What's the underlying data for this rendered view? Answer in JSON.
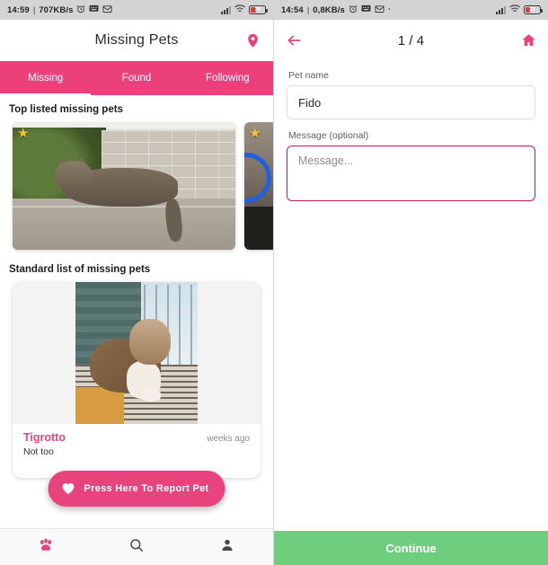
{
  "left": {
    "statusbar": {
      "clock": "14:59",
      "separator": "|",
      "netspeed": "707KB/s",
      "alarm_icon": "alarm-icon",
      "message_icon": "message-icon",
      "mail_icon": "mail-icon",
      "signal_icon": "signal-icon",
      "wifi_icon": "wifi-icon",
      "battery_icon": "battery-icon",
      "battery_level": "18"
    },
    "appbar": {
      "title": "Missing Pets",
      "action_icon": "location-pin-icon"
    },
    "tabs": [
      {
        "label": "Missing",
        "active": true
      },
      {
        "label": "Found",
        "active": false
      },
      {
        "label": "Following",
        "active": false
      }
    ],
    "sections": {
      "top_title": "Top listed missing pets",
      "standard_title": "Standard list of missing pets"
    },
    "top_cards": [
      {
        "badge_icon": "star-icon",
        "photo": "tabby-cat-on-wall"
      },
      {
        "badge_icon": "star-icon",
        "photo": "pet-with-blue-ring"
      }
    ],
    "standard_card": {
      "photo": "cat-on-porch-rug",
      "pet_name": "Tigrotto",
      "time_ago": "weeks ago",
      "description": "Not too"
    },
    "fab": {
      "icon": "heart-icon",
      "label": "Press Here To Report Pet"
    },
    "bottom_nav": [
      {
        "icon": "paw-icon",
        "active": true
      },
      {
        "icon": "search-icon",
        "active": false
      },
      {
        "icon": "person-icon",
        "active": false
      }
    ]
  },
  "right": {
    "statusbar": {
      "clock": "14:54",
      "separator": "|",
      "netspeed": "0,8KB/s",
      "alarm_icon": "alarm-icon",
      "message_icon": "message-icon",
      "mail_icon": "mail-icon",
      "dot": "·",
      "signal_icon": "signal-icon",
      "wifi_icon": "wifi-icon",
      "battery_icon": "battery-icon",
      "battery_level": "21"
    },
    "appbar": {
      "back_icon": "back-arrow-icon",
      "title": "1 / 4",
      "home_icon": "home-icon"
    },
    "form": {
      "pet_name_label": "Pet name",
      "pet_name_value": "Fido",
      "message_label": "Message (optional)",
      "message_placeholder": "Message..."
    },
    "continue_label": "Continue"
  },
  "colors": {
    "accent_pink": "#ec407a",
    "name_pink": "#e8437c",
    "focus_border": "#c2185b",
    "continue_green": "#6ece7d",
    "statusbar_gray": "#d4d4d4",
    "star_yellow": "#f6c333"
  }
}
